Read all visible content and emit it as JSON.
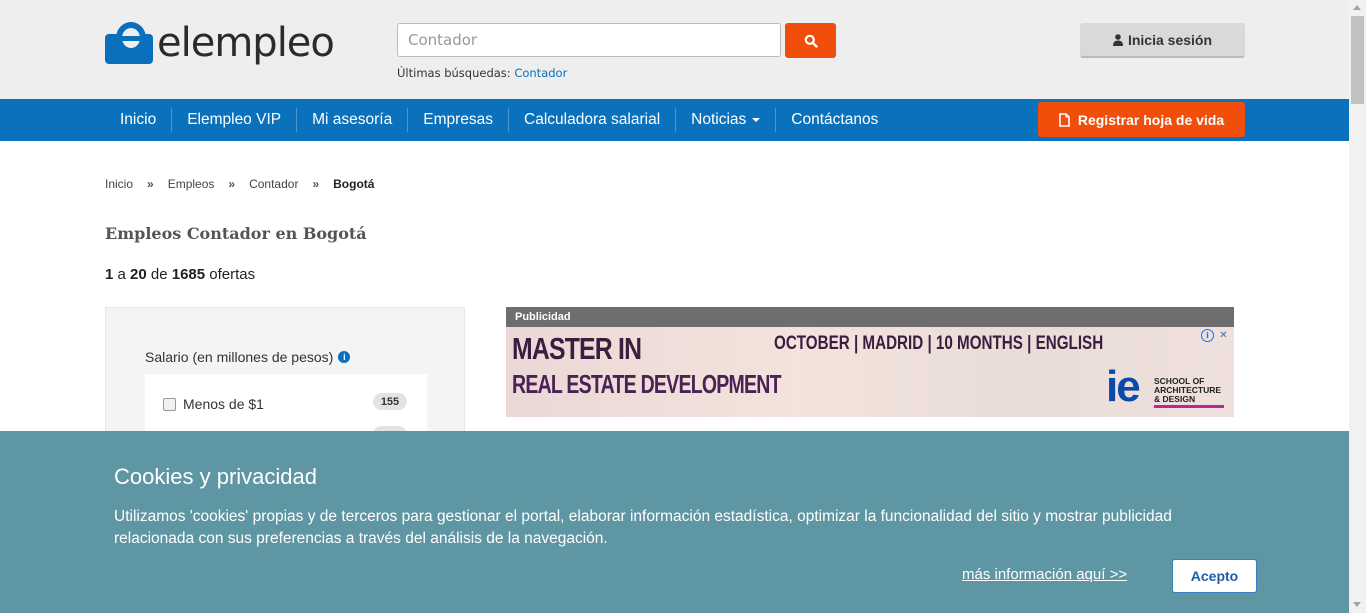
{
  "header": {
    "logo_text": "elempleo",
    "search": {
      "value": "",
      "placeholder": "Contador"
    },
    "recent_label": "Últimas búsquedas:",
    "recent_link": "Contador",
    "login_label": "Inicia sesión"
  },
  "nav": {
    "items": [
      {
        "label": "Inicio"
      },
      {
        "label": "Elempleo VIP"
      },
      {
        "label": "Mi asesoría"
      },
      {
        "label": "Empresas"
      },
      {
        "label": "Calculadora salarial"
      },
      {
        "label": "Noticias"
      },
      {
        "label": "Contáctanos"
      }
    ],
    "register_label": "Registrar hoja de vida"
  },
  "breadcrumb": {
    "items": [
      "Inicio",
      "Empleos",
      "Contador"
    ],
    "separator": "»",
    "current": "Bogotá"
  },
  "page_title": "Empleos Contador en Bogotá",
  "results": {
    "from": "1",
    "a": "a",
    "to": "20",
    "de": "de",
    "total": "1685",
    "suffix": "ofertas"
  },
  "filters": {
    "title": "Salario (en millones de pesos)",
    "info_icon": "i",
    "items": [
      {
        "label": "Menos de $1",
        "count": "155",
        "checked": false
      }
    ]
  },
  "ad": {
    "label": "Publicidad",
    "headline1": "MASTER IN",
    "headline2": "REAL ESTATE DEVELOPMENT",
    "info": "OCTOBER | MADRID | 10 MONTHS | ENGLISH",
    "brand": "ie",
    "school_line1": "SCHOOL OF",
    "school_line2": "ARCHITECTURE",
    "school_line3": "& DESIGN"
  },
  "cookie": {
    "title": "Cookies y privacidad",
    "text": "Utilizamos 'cookies' propias y de terceros para gestionar el portal, elaborar información estadística, optimizar la funcionalidad del sitio y mostrar publicidad relacionada con sus preferencias a través del análisis de la navegación.",
    "link": "más información aquí >>",
    "accept": "Acepto"
  },
  "colors": {
    "brand_blue": "#0a71bd",
    "accent_orange": "#f04e0a",
    "cookie_bg": "#5f96a4"
  }
}
